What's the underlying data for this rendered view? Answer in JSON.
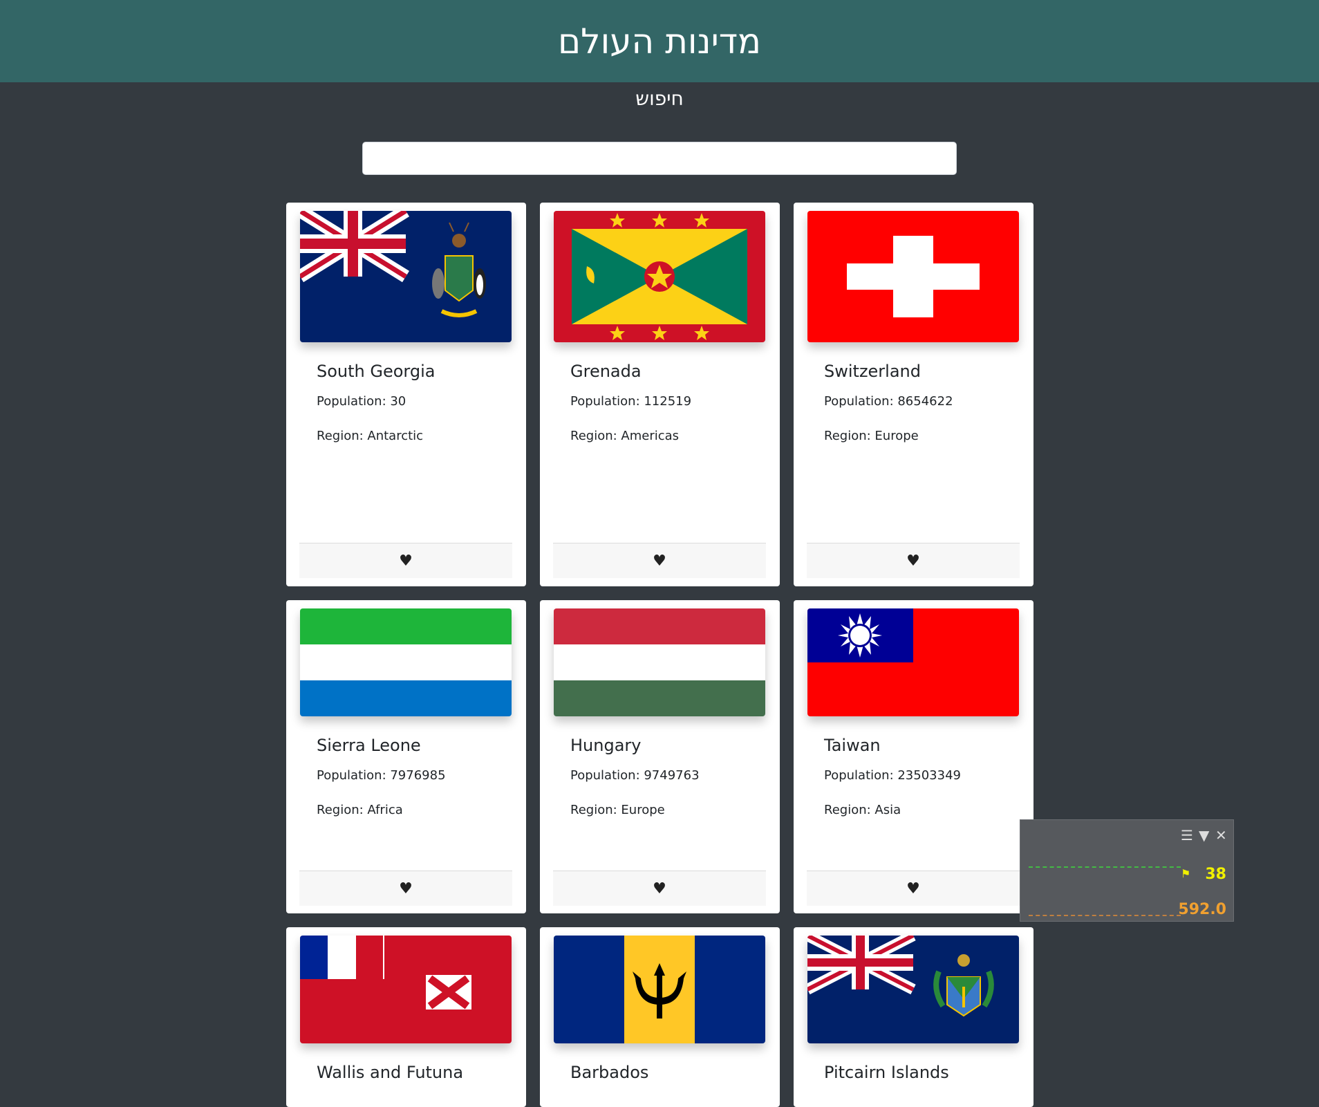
{
  "header": {
    "title": "מדינות העולם"
  },
  "search": {
    "label": "חיפוש",
    "value": "",
    "placeholder": ""
  },
  "countries": [
    {
      "name": "South Georgia",
      "population": "Population: 30",
      "region": "Region: Antarctic",
      "flag": "south-georgia"
    },
    {
      "name": "Grenada",
      "population": "Population: 112519",
      "region": "Region: Americas",
      "flag": "grenada"
    },
    {
      "name": "Switzerland",
      "population": "Population: 8654622",
      "region": "Region: Europe",
      "flag": "switzerland"
    },
    {
      "name": "Sierra Leone",
      "population": "Population: 7976985",
      "region": "Region: Africa",
      "flag": "sierra-leone"
    },
    {
      "name": "Hungary",
      "population": "Population: 9749763",
      "region": "Region: Europe",
      "flag": "hungary"
    },
    {
      "name": "Taiwan",
      "population": "Population: 23503349",
      "region": "Region: Asia",
      "flag": "taiwan"
    },
    {
      "name": "Wallis and Futuna",
      "population": "",
      "region": "",
      "flag": "wallis-and-futuna"
    },
    {
      "name": "Barbados",
      "population": "",
      "region": "",
      "flag": "barbados"
    },
    {
      "name": "Pitcairn Islands",
      "population": "",
      "region": "",
      "flag": "pitcairn-islands"
    }
  ],
  "favorite_icon": "heart-icon",
  "overlay": {
    "value1": "38",
    "value2": "592.0",
    "color1": "#f0f000",
    "color2": "#f0a030"
  },
  "colors": {
    "header_bg": "#336666",
    "page_bg": "#343a40"
  }
}
